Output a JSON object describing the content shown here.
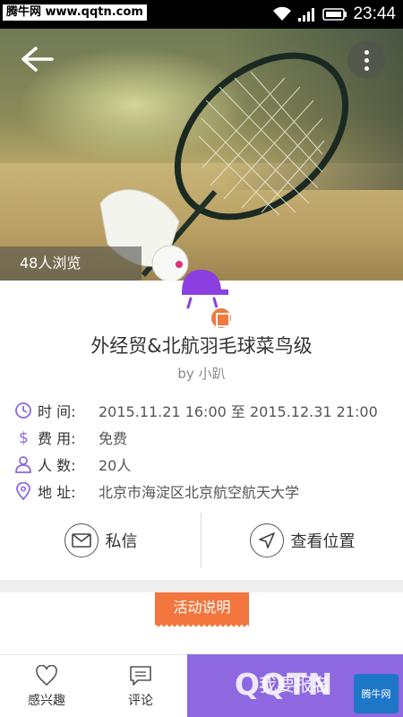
{
  "status": {
    "watermark": "腾牛网 www.qqtn.com",
    "time": "23:44"
  },
  "hero": {
    "views": "48人浏览"
  },
  "event": {
    "title": "外经贸&北航羽毛球菜鸟级",
    "byline": "by 小趴",
    "rows": [
      {
        "label": "时 间:",
        "value": "2015.11.21 16:00  至  2015.12.31 21:00"
      },
      {
        "label": "费 用:",
        "value": "免费"
      },
      {
        "label": "人 数:",
        "value": "20人"
      },
      {
        "label": "地 址:",
        "value": "北京市海淀区北京航空航天大学"
      }
    ]
  },
  "actions": {
    "message": "私信",
    "location": "查看位置"
  },
  "section": {
    "tab": "活动说明"
  },
  "bottom": {
    "interest": "感兴趣",
    "comment": "评论",
    "signup": "我要报名",
    "overlay_text": "QQTN",
    "overlay_logo": "腾牛网"
  },
  "colors": {
    "accent": "#8e68e0",
    "orange": "#f2763d",
    "icon": "#8e68e0"
  }
}
